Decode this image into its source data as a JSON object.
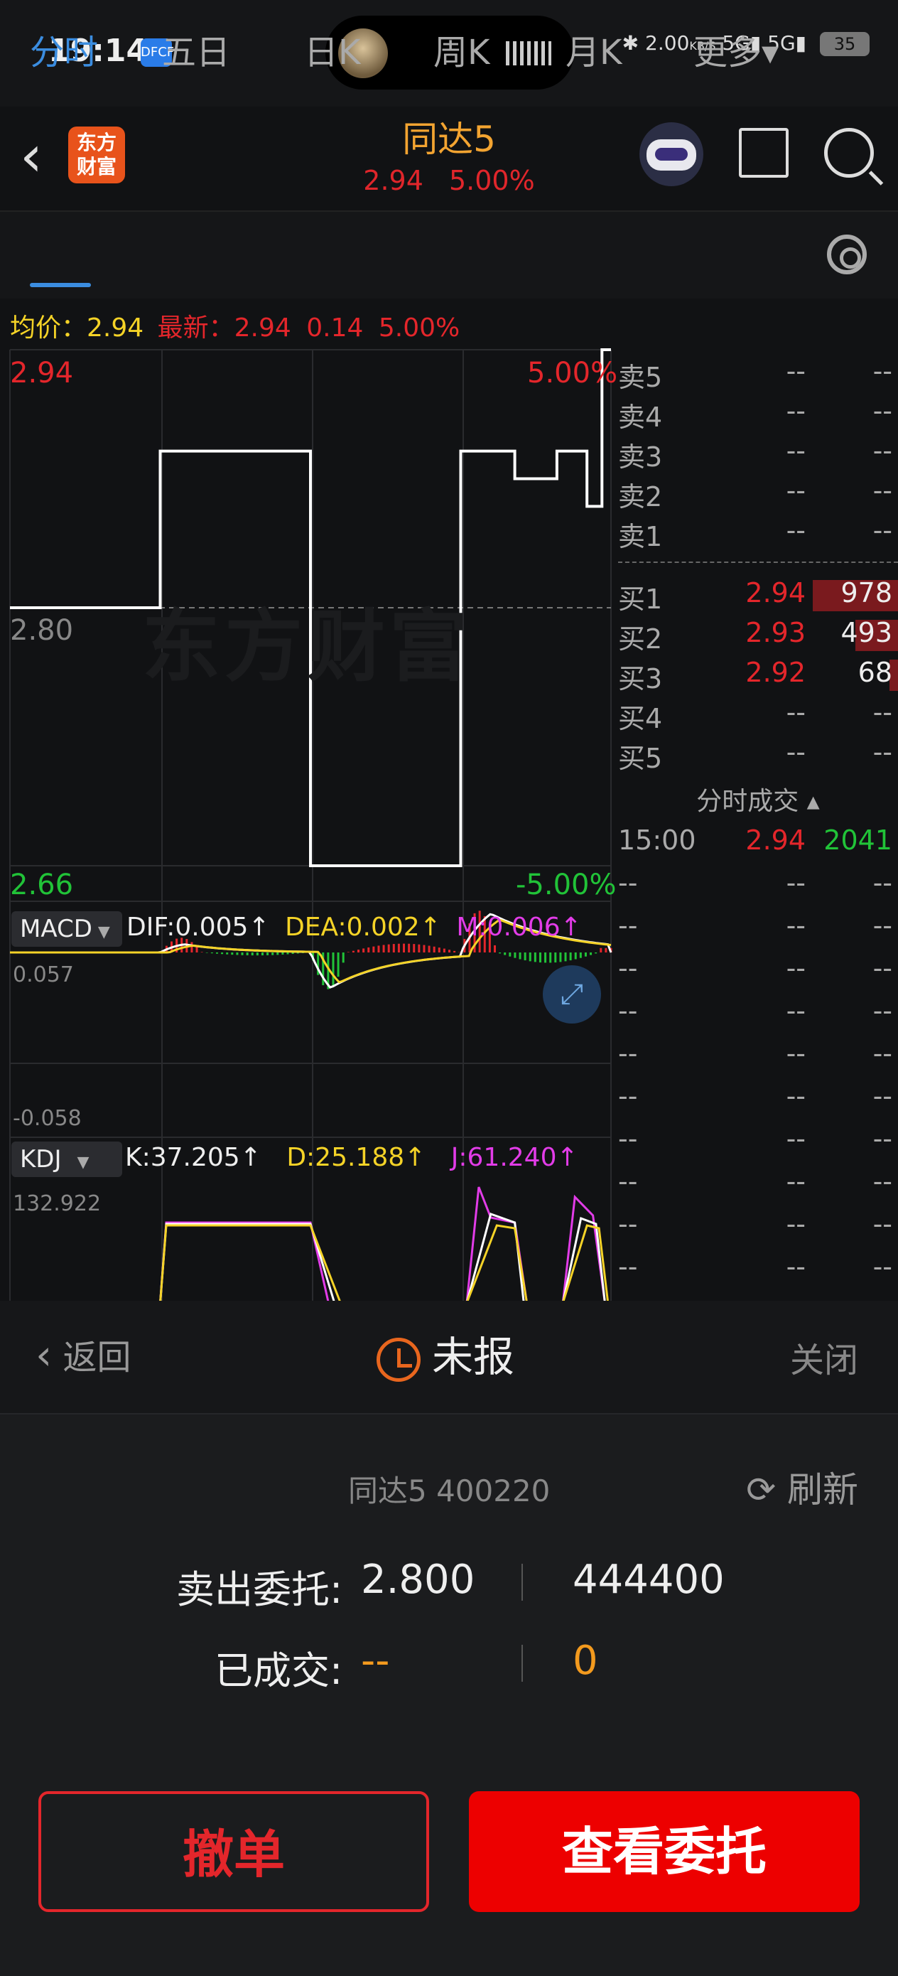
{
  "status_bar": {
    "time": "19:14",
    "app_badge": "DFCF",
    "net_speed": "2.00",
    "net_unit": "KB/S",
    "signal1": "5G",
    "signal2": "5G",
    "battery": "35"
  },
  "header": {
    "brand_logo": "东方\n财富",
    "title": "同达5",
    "price": "2.94",
    "change_pct": "5.00%"
  },
  "tabs": {
    "items": [
      "分时",
      "五日",
      "日K",
      "周K",
      "月K",
      "更多▾"
    ],
    "active": "分时"
  },
  "quote_line": {
    "avg_label": "均价：",
    "avg_value": "2.94",
    "latest_label": "最新：",
    "latest_value": "2.94",
    "change": "0.14",
    "change_pct": "5.00%"
  },
  "chart_data": [
    {
      "type": "line",
      "name": "分时",
      "x": [
        0,
        0.25,
        0.25,
        0.5,
        0.5,
        0.75,
        0.75,
        0.84,
        0.84,
        0.91,
        0.91,
        0.96,
        0.96,
        0.985,
        0.985,
        1.0
      ],
      "y": [
        2.8,
        2.8,
        2.885,
        2.885,
        2.66,
        2.66,
        2.885,
        2.885,
        2.87,
        2.87,
        2.885,
        2.885,
        2.855,
        2.855,
        2.94,
        2.94
      ],
      "ylim": [
        2.66,
        2.94
      ],
      "y_left_top": "2.94",
      "y_left_mid": "2.80",
      "y_left_bottom": "2.66",
      "y_right_top": "5.00%",
      "y_right_bottom": "-5.00%",
      "watermark": "东方财富",
      "colors": {
        "price": "#ffffff",
        "up": "#e4262b",
        "down": "#21c338"
      }
    },
    {
      "type": "line",
      "name": "MACD",
      "selector": "MACD",
      "dif": "DIF:0.005↑",
      "dea": "DEA:0.002↑",
      "m": "M:0.006↑",
      "ymax_label": "0.057",
      "ymin_label": "-0.058",
      "ylim": [
        -0.058,
        0.057
      ],
      "colors": {
        "dif": "#ffffff",
        "dea": "#f5d327",
        "pos": "#e4262b",
        "neg": "#21c338"
      }
    },
    {
      "type": "line",
      "name": "KDJ",
      "selector": "KDJ",
      "k": "K:37.205↑",
      "d": "D:25.188↑",
      "j": "J:61.240↑",
      "ymax_label": "132.922",
      "colors": {
        "k": "#ffffff",
        "d": "#f5d327",
        "j": "#e23ce8"
      }
    }
  ],
  "order_book": {
    "asks": [
      {
        "label": "卖5",
        "price": "--",
        "vol": "--"
      },
      {
        "label": "卖4",
        "price": "--",
        "vol": "--"
      },
      {
        "label": "卖3",
        "price": "--",
        "vol": "--"
      },
      {
        "label": "卖2",
        "price": "--",
        "vol": "--"
      },
      {
        "label": "卖1",
        "price": "--",
        "vol": "--"
      }
    ],
    "bids": [
      {
        "label": "买1",
        "price": "2.94",
        "vol": "978"
      },
      {
        "label": "买2",
        "price": "2.93",
        "vol": "493"
      },
      {
        "label": "买3",
        "price": "2.92",
        "vol": "68"
      },
      {
        "label": "买4",
        "price": "--",
        "vol": "--"
      },
      {
        "label": "买5",
        "price": "--",
        "vol": "--"
      }
    ],
    "trades_title": "分时成交 ▴",
    "trades": [
      {
        "time": "15:00",
        "price": "2.94",
        "vol": "2041"
      },
      {
        "time": "--",
        "price": "--",
        "vol": "--"
      },
      {
        "time": "--",
        "price": "--",
        "vol": "--"
      },
      {
        "time": "--",
        "price": "--",
        "vol": "--"
      },
      {
        "time": "--",
        "price": "--",
        "vol": "--"
      },
      {
        "time": "--",
        "price": "--",
        "vol": "--"
      },
      {
        "time": "--",
        "price": "--",
        "vol": "--"
      },
      {
        "time": "--",
        "price": "--",
        "vol": "--"
      },
      {
        "time": "--",
        "price": "--",
        "vol": "--"
      },
      {
        "time": "--",
        "price": "--",
        "vol": "--"
      },
      {
        "time": "--",
        "price": "--",
        "vol": "--"
      }
    ]
  },
  "order_panel": {
    "back_label": "返回",
    "status": "未报",
    "close_label": "关闭",
    "stock_code": "同达5 400220",
    "refresh_label": "刷新",
    "sell_label": "卖出委托:",
    "sell_price": "2.800",
    "sell_qty": "444400",
    "filled_label": "已成交:",
    "filled_price": "--",
    "filled_qty": "0",
    "cancel_button": "撤单",
    "view_button": "查看委托"
  }
}
